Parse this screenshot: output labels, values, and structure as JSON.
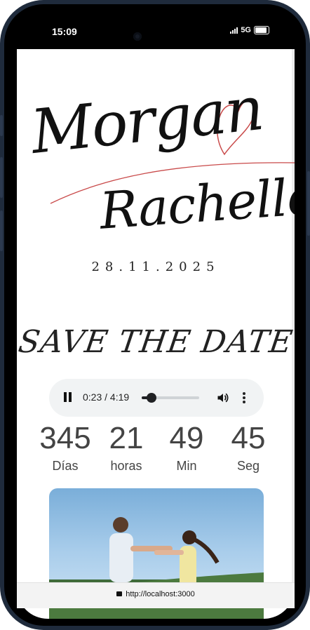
{
  "status": {
    "time": "15:09",
    "network": "5G"
  },
  "invite": {
    "name1": "Morgan",
    "name2": "Rachelle",
    "date": "28.11.2025",
    "save_the_date": "SAVE THE DATE"
  },
  "audio": {
    "time": "0:23 / 4:19",
    "progress": 0.089
  },
  "countdown": [
    {
      "value": "345",
      "label": "Días"
    },
    {
      "value": "21",
      "label": "horas"
    },
    {
      "value": "49",
      "label": "Min"
    },
    {
      "value": "45",
      "label": "Seg"
    }
  ],
  "browser": {
    "url": "http://localhost:3000"
  },
  "colors": {
    "accent": "#c94a4a",
    "player_bg": "#f1f3f4"
  }
}
